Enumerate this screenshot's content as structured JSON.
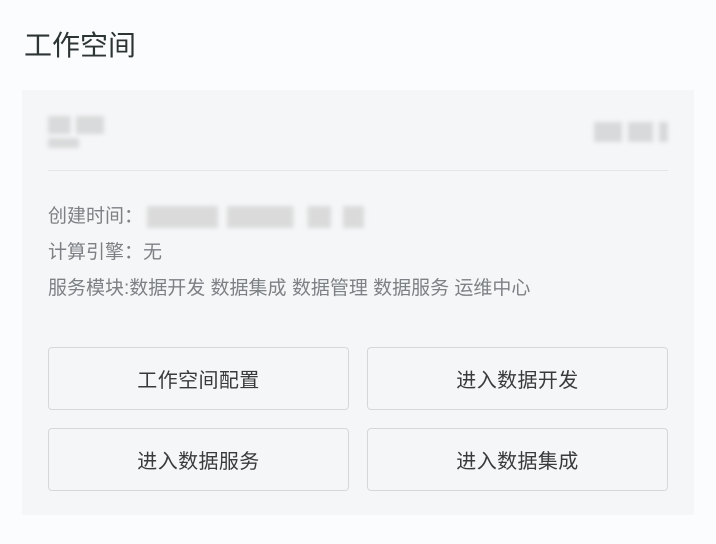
{
  "page": {
    "title": "工作空间"
  },
  "card": {
    "meta": {
      "created_label": "创建时间：",
      "engine_label": "计算引擎：",
      "engine_value": "无",
      "modules_label": "服务模块:",
      "modules_value": "数据开发 数据集成 数据管理 数据服务 运维中心"
    },
    "actions": {
      "config": "工作空间配置",
      "dev": "进入数据开发",
      "service": "进入数据服务",
      "integration": "进入数据集成"
    }
  }
}
